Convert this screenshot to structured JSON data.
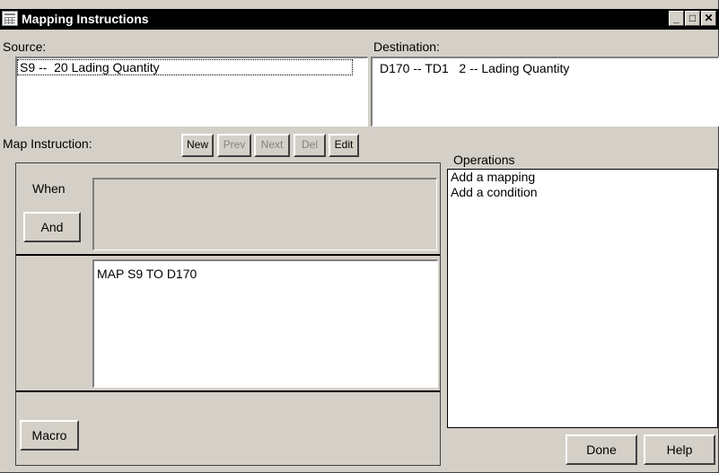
{
  "window": {
    "title": "Mapping Instructions",
    "minimize_glyph": "_",
    "maximize_glyph": "□",
    "close_glyph": "✕"
  },
  "source": {
    "label": "Source:",
    "value": "S9 --  20 Lading Quantity"
  },
  "destination": {
    "label": "Destination:",
    "value": "D170 -- TD1   2 -- Lading Quantity"
  },
  "map_instruction": {
    "label": "Map Instruction:",
    "buttons": {
      "new": "New",
      "prev": "Prev",
      "next": "Next",
      "del": "Del",
      "edit": "Edit"
    }
  },
  "when_section": {
    "label": "When",
    "and_button": "And",
    "condition_text": ""
  },
  "instruction_text": "MAP S9 TO D170",
  "macro_button": "Macro",
  "operations": {
    "label": "Operations",
    "items": [
      "Add a mapping",
      "Add a condition"
    ]
  },
  "footer": {
    "done": "Done",
    "help": "Help"
  }
}
